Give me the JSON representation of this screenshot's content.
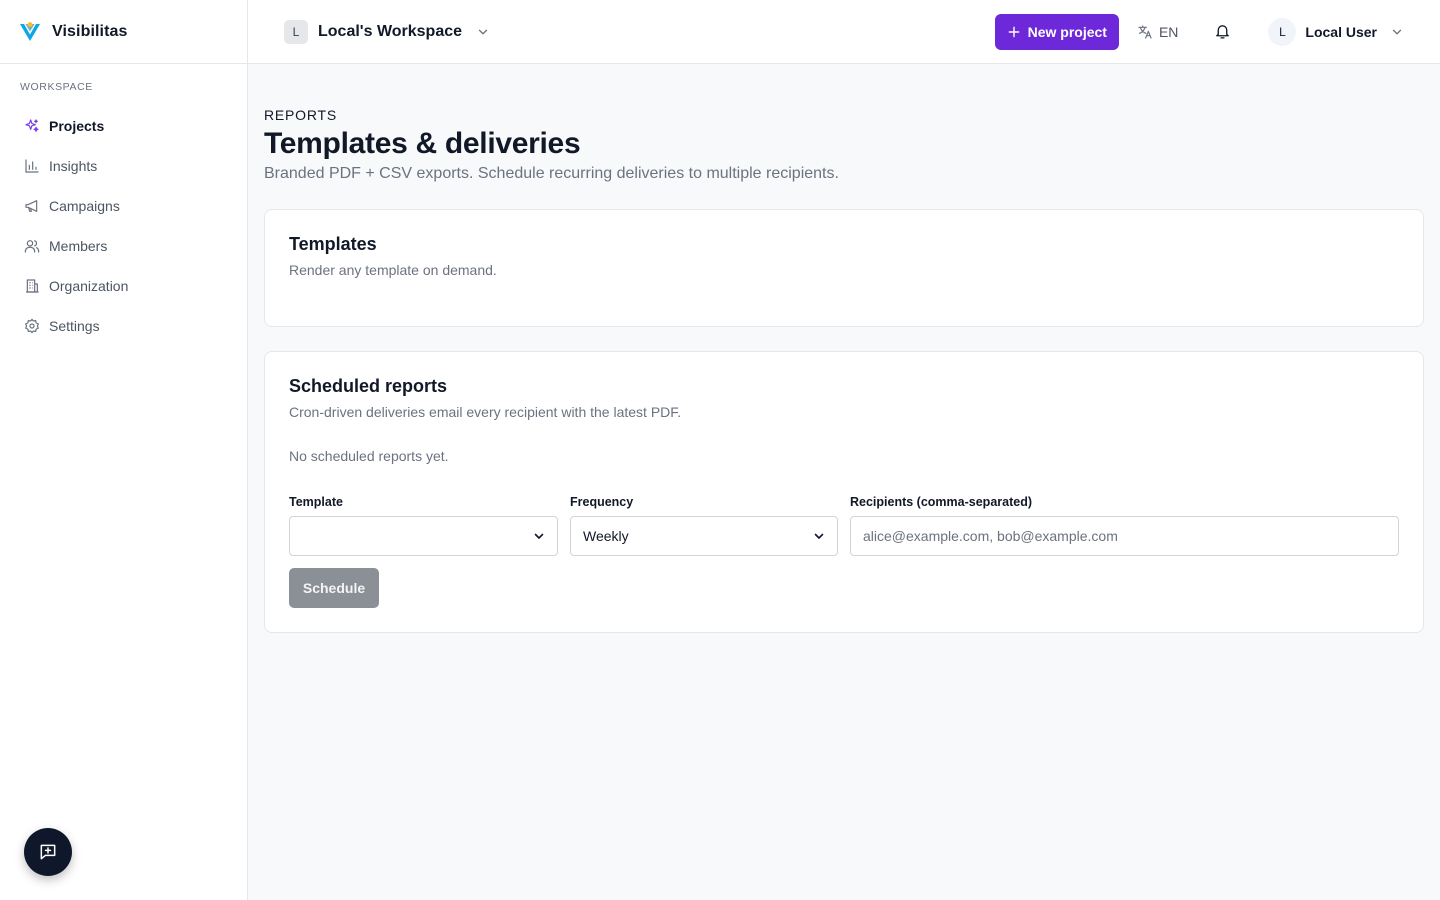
{
  "brand": {
    "name": "Visibilitas"
  },
  "sidebar": {
    "section_label": "Workspace",
    "items": [
      {
        "label": "Projects",
        "icon": "sparkles-icon",
        "active": true
      },
      {
        "label": "Insights",
        "icon": "bar-chart-icon"
      },
      {
        "label": "Campaigns",
        "icon": "megaphone-icon"
      },
      {
        "label": "Members",
        "icon": "users-icon"
      },
      {
        "label": "Organization",
        "icon": "building-icon"
      },
      {
        "label": "Settings",
        "icon": "gear-icon"
      }
    ]
  },
  "topbar": {
    "workspace_initial": "L",
    "workspace_name": "Local's Workspace",
    "new_project_label": "New project",
    "language": "EN",
    "user_initial": "L",
    "user_name": "Local User"
  },
  "page": {
    "eyebrow": "Reports",
    "title": "Templates & deliveries",
    "subtitle": "Branded PDF + CSV exports. Schedule recurring deliveries to multiple recipients."
  },
  "templates_card": {
    "title": "Templates",
    "subtitle": "Render any template on demand."
  },
  "scheduled_card": {
    "title": "Scheduled reports",
    "subtitle": "Cron-driven deliveries email every recipient with the latest PDF.",
    "empty_text": "No scheduled reports yet.",
    "form": {
      "template_label": "Template",
      "template_value": "",
      "frequency_label": "Frequency",
      "frequency_value": "Weekly",
      "recipients_label": "Recipients (comma-separated)",
      "recipients_placeholder": "alice@example.com, bob@example.com",
      "submit_label": "Schedule"
    }
  },
  "colors": {
    "accent": "#6d28d9",
    "logo_blue": "#0ea5e9",
    "logo_yellow": "#fbbf24",
    "fab": "#0f172a",
    "disabled_button": "#8b8f96"
  }
}
